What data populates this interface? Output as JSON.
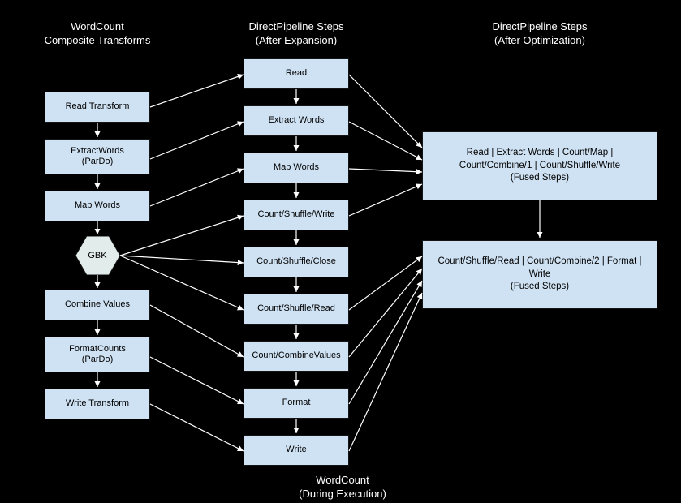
{
  "labels": {
    "col1_top": "WordCount\nComposite Transforms",
    "col2_top": "DirectPipeline Steps\n(After Expansion)",
    "col3_top": "DirectPipeline Steps\n(After Optimization)",
    "bottom": "WordCount\n(During Execution)"
  },
  "col1": {
    "readTransform": "Read Transform",
    "extractWords": "ExtractWords\n(ParDo)",
    "mapWords": "Map Words",
    "gbk": "GBK",
    "combineValues": "Combine Values",
    "formatCounts": "FormatCounts\n(ParDo)",
    "writeTransform": "Write Transform"
  },
  "col2": {
    "read": "Read",
    "extractWords": "Extract Words",
    "mapWords": "Map Words",
    "countShuffleWrite": "Count/Shuffle/Write",
    "countShuffleClose": "Count/Shuffle/Close",
    "countShuffleRead": "Count/Shuffle/Read",
    "countCombineValues": "Count/CombineValues",
    "format": "Format",
    "write": "Write"
  },
  "col3": {
    "fused1": "Read | Extract Words | Count/Map | Count/Combine/1 | Count/Shuffle/Write\n(Fused Steps)",
    "fused2": "Count/Shuffle/Read | Count/Combine/2 | Format | Write\n(Fused Steps)"
  }
}
